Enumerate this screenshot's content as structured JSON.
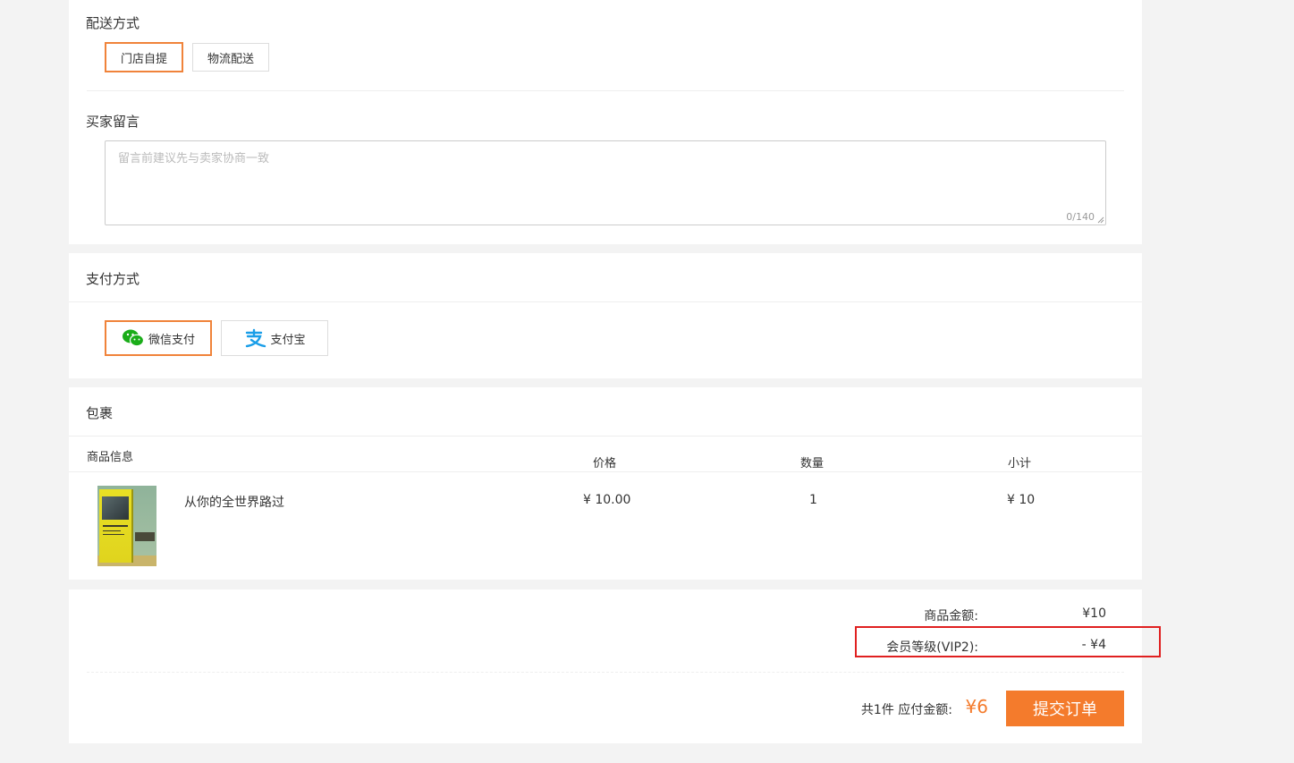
{
  "delivery": {
    "title": "配送方式",
    "options": [
      {
        "label": "门店自提",
        "selected": true
      },
      {
        "label": "物流配送",
        "selected": false
      }
    ]
  },
  "message": {
    "title": "买家留言",
    "placeholder": "留言前建议先与卖家协商一致",
    "counter": "0/140"
  },
  "payment": {
    "title": "支付方式",
    "options": [
      {
        "label": "微信支付",
        "icon": "wechat-pay-icon",
        "selected": true
      },
      {
        "label": "支付宝",
        "icon": "alipay-icon",
        "selected": false
      }
    ]
  },
  "package": {
    "title": "包裹",
    "columns": [
      "商品信息",
      "价格",
      "数量",
      "小计"
    ],
    "items": [
      {
        "name": "从你的全世界路过",
        "price": "¥ 10.00",
        "quantity": "1",
        "subtotal": "¥ 10"
      }
    ]
  },
  "summary": {
    "goods_label": "商品金额:",
    "goods_value": "¥10",
    "vip_label": "会员等级(VIP2):",
    "vip_value": "- ¥4",
    "total_prefix": "共1件 应付金额:",
    "total_value": "¥6",
    "submit_label": "提交订单"
  },
  "colors": {
    "accent": "#f0833a",
    "submit": "#f47b2c",
    "highlight_box": "#e02020",
    "wechat": "#1aad19",
    "alipay": "#1a9ee8"
  }
}
